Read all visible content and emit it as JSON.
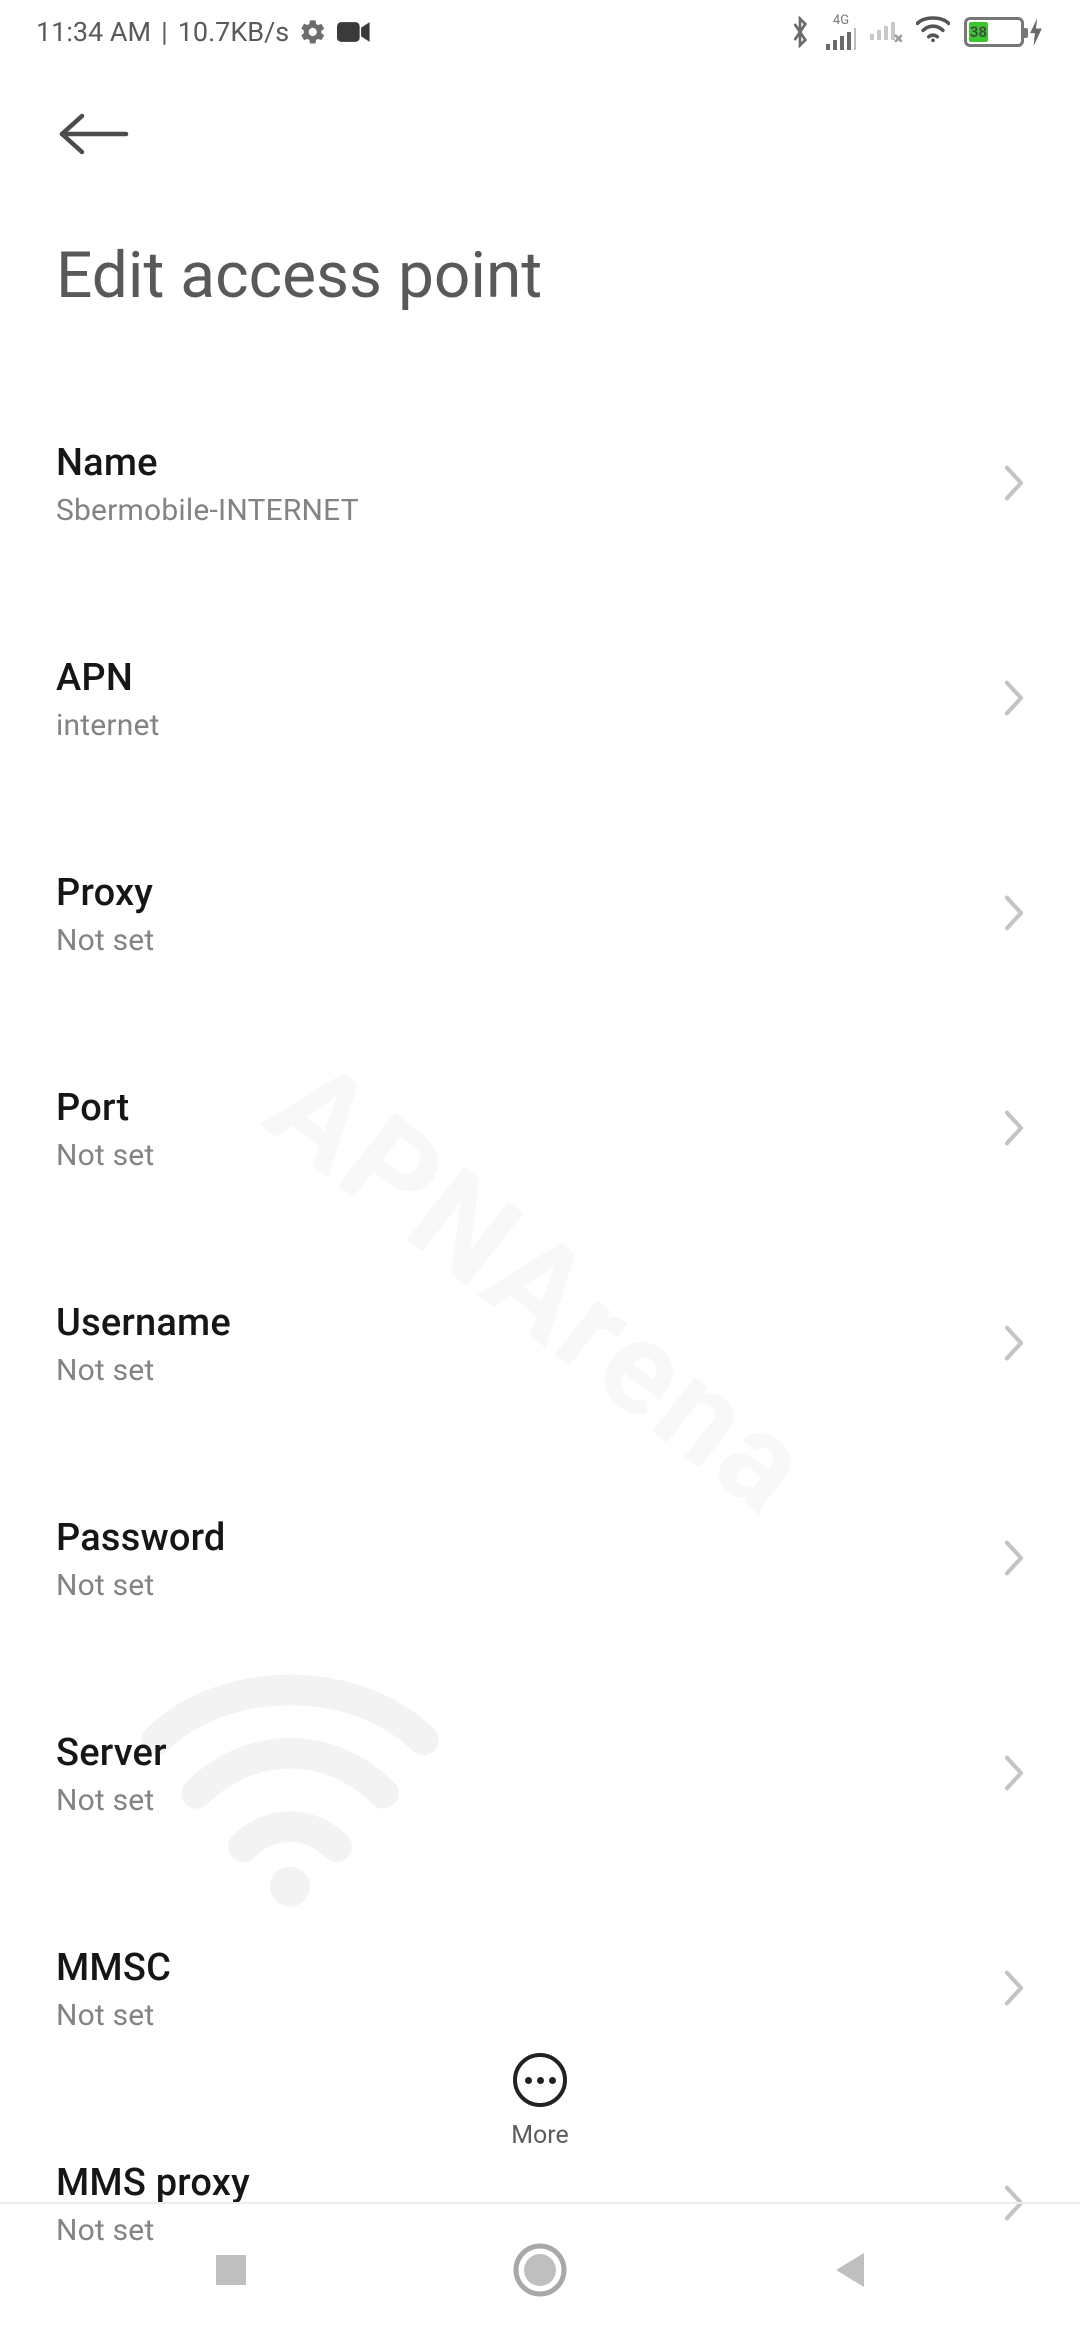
{
  "status_bar": {
    "time": "11:34 AM",
    "separator": "|",
    "speed": "10.7KB/s",
    "signal_type": "4G",
    "battery_percent": "38"
  },
  "header": {
    "title": "Edit access point"
  },
  "rows": [
    {
      "label": "Name",
      "value": "Sbermobile-INTERNET"
    },
    {
      "label": "APN",
      "value": "internet"
    },
    {
      "label": "Proxy",
      "value": "Not set"
    },
    {
      "label": "Port",
      "value": "Not set"
    },
    {
      "label": "Username",
      "value": "Not set"
    },
    {
      "label": "Password",
      "value": "Not set"
    },
    {
      "label": "Server",
      "value": "Not set"
    },
    {
      "label": "MMSC",
      "value": "Not set"
    },
    {
      "label": "MMS proxy",
      "value": "Not set"
    }
  ],
  "bottom_action": {
    "label": "More"
  }
}
